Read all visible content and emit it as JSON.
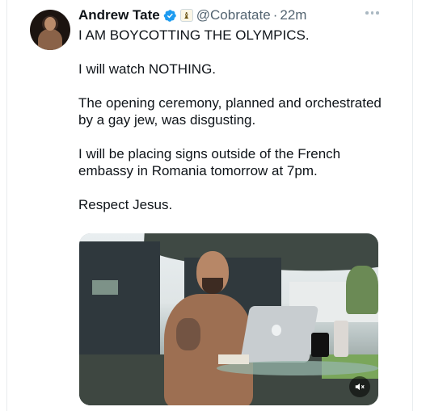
{
  "tweet": {
    "author_name": "Andrew Tate",
    "handle": "@Cobratate",
    "separator": "·",
    "time": "22m",
    "badge_glyph": "♝",
    "colors": {
      "verified": "#1d9bf0",
      "text": "#0f1419",
      "secondary": "#536471"
    },
    "body": [
      "I AM BOYCOTTING THE OLYMPICS.",
      "I will watch NOTHING.",
      "The opening ceremony, planned and orchestrated by a gay jew, was disgusting.",
      "I will be placing signs outside of the French embassy in Romania tomorrow at 7pm.",
      "Respect Jesus."
    ],
    "media": {
      "type": "video",
      "icons": {
        "mute": "speaker-muted-icon"
      }
    }
  }
}
